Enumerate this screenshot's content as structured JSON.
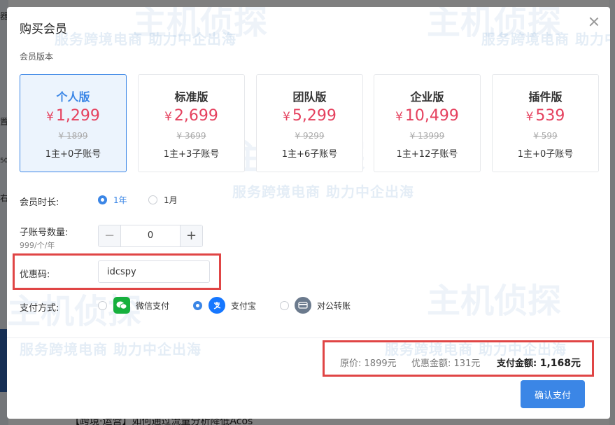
{
  "background": {
    "left_fragments": [
      "器",
      "置",
      "50·",
      "右"
    ],
    "bottom_text": "【跨境·运营】如何通过流量分析降低Acos"
  },
  "dialog": {
    "title": "购买会员",
    "section_label": "会员版本"
  },
  "plans": [
    {
      "name": "个人版",
      "price": "1,299",
      "original": "¥ 1899",
      "accounts": "1主+0子账号",
      "selected": true
    },
    {
      "name": "标准版",
      "price": "2,699",
      "original": "¥ 3699",
      "accounts": "1主+3子账号",
      "selected": false
    },
    {
      "name": "团队版",
      "price": "5,299",
      "original": "¥ 9299",
      "accounts": "1主+6子账号",
      "selected": false
    },
    {
      "name": "企业版",
      "price": "10,499",
      "original": "¥ 13999",
      "accounts": "1主+12子账号",
      "selected": false
    },
    {
      "name": "插件版",
      "price": "539",
      "original": "¥ 599",
      "accounts": "1主+0子账号",
      "selected": false
    }
  ],
  "currency_symbol": "¥",
  "duration": {
    "label": "会员时长:",
    "options": [
      "1年",
      "1月"
    ],
    "selected": "1年"
  },
  "subaccounts": {
    "label": "子账号数量:",
    "sublabel": "999/个/年",
    "minus": "−",
    "plus": "+",
    "value": "0"
  },
  "coupon": {
    "label": "优惠码:",
    "value": "idcspy"
  },
  "payment": {
    "label": "支付方式:",
    "options": [
      "微信支付",
      "支付宝",
      "对公转账"
    ],
    "selected": "支付宝"
  },
  "summary": {
    "original_label": "原价:",
    "original_value": "1899元",
    "discount_label": "优惠金额:",
    "discount_value": "131元",
    "total_label": "支付金额:",
    "total_value": "1,168元"
  },
  "confirm_label": "确认支付",
  "watermark": {
    "text": "服务跨境电商 助力中企出海",
    "logo": "主机侦探"
  },
  "colors": {
    "accent": "#3b86e6",
    "price": "#e5415e",
    "highlight_box": "#e04545",
    "wechat": "#16b03d",
    "alipay": "#1677ff"
  }
}
